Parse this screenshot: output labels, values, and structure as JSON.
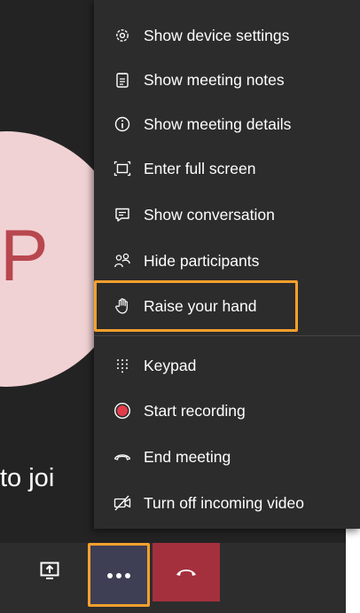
{
  "meeting": {
    "avatar_initial": "P",
    "join_text": "to joi"
  },
  "menu": {
    "items": [
      {
        "label": "Show device settings",
        "icon": "gear-icon"
      },
      {
        "label": "Show meeting notes",
        "icon": "notes-icon"
      },
      {
        "label": "Show meeting details",
        "icon": "info-icon"
      },
      {
        "label": "Enter full screen",
        "icon": "fullscreen-icon"
      },
      {
        "label": "Show conversation",
        "icon": "chat-icon"
      },
      {
        "label": "Hide participants",
        "icon": "participants-icon"
      },
      {
        "label": "Raise your hand",
        "icon": "hand-icon"
      },
      {
        "label": "Keypad",
        "icon": "keypad-icon"
      },
      {
        "label": "Start recording",
        "icon": "record-icon"
      },
      {
        "label": "End meeting",
        "icon": "end-call-icon"
      },
      {
        "label": "Turn off incoming video",
        "icon": "video-off-icon"
      }
    ]
  },
  "toolbar": {
    "buttons": [
      {
        "name": "share-screen",
        "icon": "share-screen-icon"
      },
      {
        "name": "more-actions",
        "icon": "more-icon"
      },
      {
        "name": "hang-up",
        "icon": "hang-up-icon"
      }
    ]
  },
  "colors": {
    "accent_highlight": "#f7a02d",
    "record": "#e23c4b",
    "hangup": "#a4303e",
    "menu_bg": "#2d2c2c",
    "avatar_bg": "#f1d2d4"
  }
}
